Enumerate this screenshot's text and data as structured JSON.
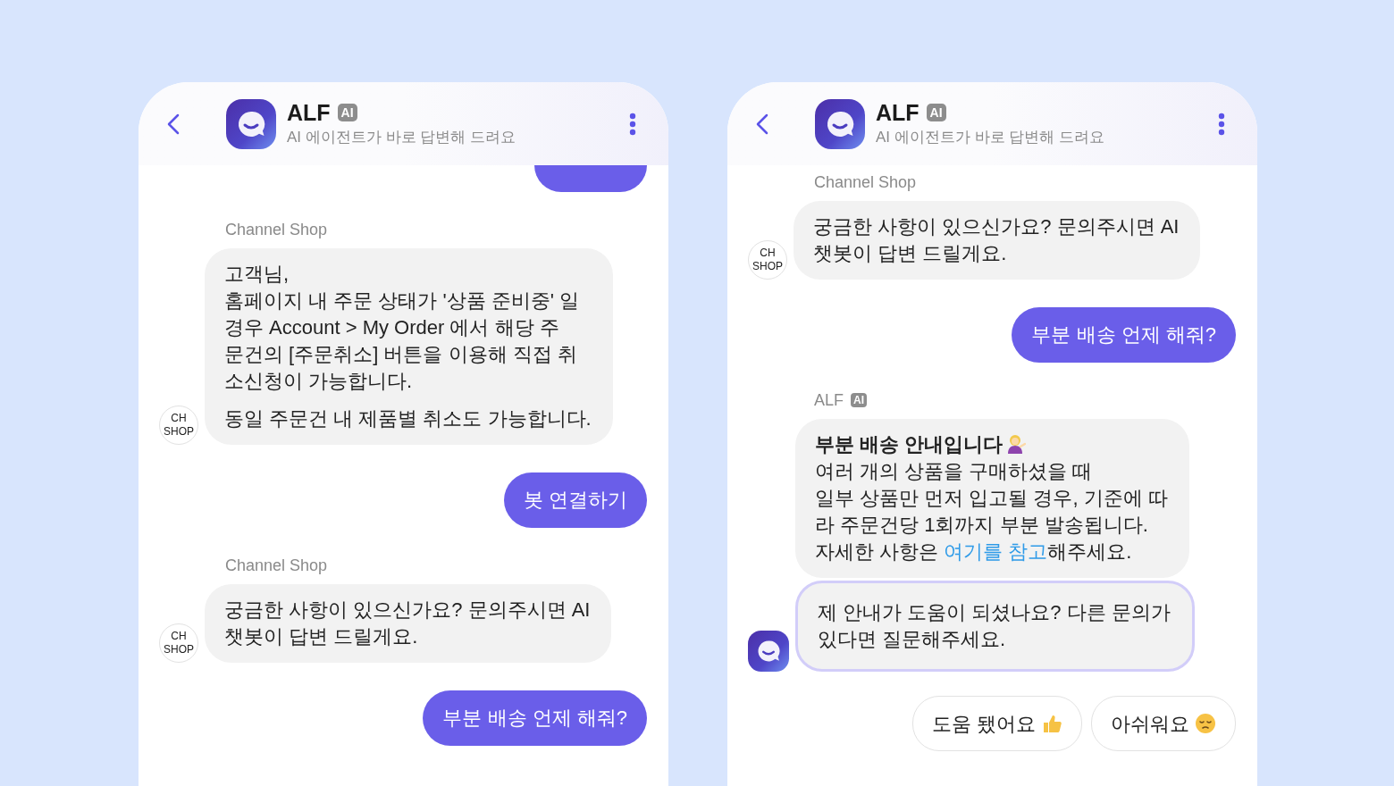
{
  "phones": [
    {
      "header": {
        "name": "ALF",
        "badge": "AI",
        "subtitle": "AI 에이전트가 바로 답변해 드려요"
      },
      "messages": [
        {
          "kind": "partial"
        },
        {
          "kind": "sender",
          "name": "Channel Shop"
        },
        {
          "kind": "bot",
          "avatar": {
            "kind": "shop",
            "lines": [
              "CH",
              "SHOP"
            ]
          },
          "bubbles": [
            {
              "highlighted": false,
              "paragraphs": [
                {
                  "kind": "text",
                  "lines": [
                    "고객님,",
                    "홈페이지 내 주문 상태가 '상품 준비중' 일",
                    "경우 Account > My Order 에서 해당 주",
                    "문건의 [주문취소] 버튼을 이용해 직접 취",
                    "소신청이 가능합니다."
                  ]
                },
                {
                  "kind": "text",
                  "lines": [
                    "동일 주문건 내 제품별 취소도 가능합니다."
                  ]
                }
              ]
            }
          ]
        },
        {
          "kind": "user",
          "text": "봇 연결하기"
        },
        {
          "kind": "sender",
          "name": "Channel Shop"
        },
        {
          "kind": "bot",
          "avatar": {
            "kind": "shop",
            "lines": [
              "CH",
              "SHOP"
            ]
          },
          "bubbles": [
            {
              "highlighted": false,
              "paragraphs": [
                {
                  "kind": "text",
                  "lines": [
                    "궁금한 사항이 있으신가요? 문의주시면 AI",
                    "챗봇이 답변 드릴게요."
                  ]
                }
              ]
            }
          ]
        },
        {
          "kind": "user",
          "text": "부분 배송 언제 해줘?"
        }
      ]
    },
    {
      "header": {
        "name": "ALF",
        "badge": "AI",
        "subtitle": "AI 에이전트가 바로 답변해 드려요"
      },
      "messages": [
        {
          "kind": "sender",
          "name": "Channel Shop"
        },
        {
          "kind": "bot",
          "avatar": {
            "kind": "shop",
            "lines": [
              "CH",
              "SHOP"
            ]
          },
          "bubbles": [
            {
              "highlighted": false,
              "paragraphs": [
                {
                  "kind": "text",
                  "lines": [
                    "궁금한 사항이 있으신가요? 문의주시면 AI",
                    "챗봇이 답변 드릴게요."
                  ]
                }
              ]
            }
          ]
        },
        {
          "kind": "user",
          "text": "부분 배송 언제 해줘?"
        },
        {
          "kind": "sender",
          "name": "ALF",
          "badge": "AI"
        },
        {
          "kind": "bot",
          "avatar": {
            "kind": "alf"
          },
          "bubbles": [
            {
              "highlighted": false,
              "paragraphs": [
                {
                  "kind": "heading",
                  "lines": [
                    "부분 배송 안내입니다"
                  ]
                },
                {
                  "kind": "text",
                  "lines": [
                    "여러 개의 상품을 구매하셨을 때",
                    "일부 상품만 먼저 입고될 경우, 기준에 따",
                    "라 주문건당 1회까지 부분 발송됩니다."
                  ],
                  "link_line": {
                    "before": "자세한 사항은 ",
                    "link": "여기를 참고",
                    "after": "해주세요."
                  }
                }
              ]
            },
            {
              "highlighted": true,
              "paragraphs": [
                {
                  "kind": "text",
                  "lines": [
                    "제 안내가 도움이 되셨나요? 다른 문의가",
                    "있다면 질문해주세요."
                  ]
                }
              ]
            }
          ]
        },
        {
          "kind": "quick_replies",
          "options": [
            "도움 됐어요",
            "아쉬워요"
          ]
        }
      ]
    }
  ]
}
